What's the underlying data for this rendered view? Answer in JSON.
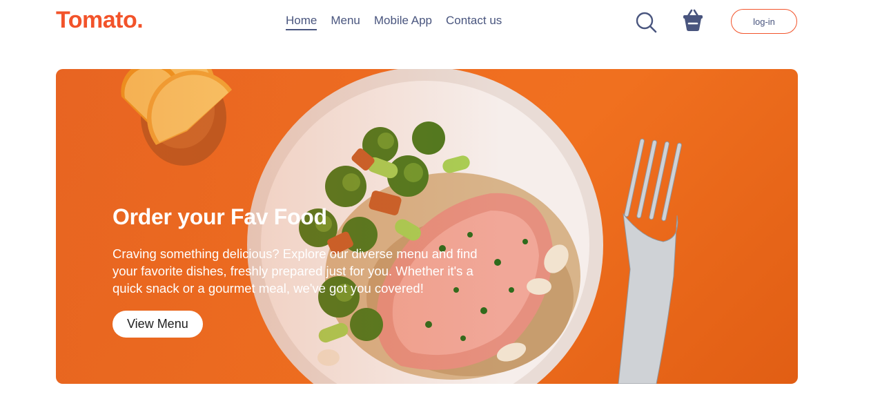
{
  "brand": {
    "logo": "Tomato.",
    "accent_color": "#f2532a"
  },
  "nav": {
    "items": [
      {
        "label": "Home",
        "active": true
      },
      {
        "label": "Menu",
        "active": false
      },
      {
        "label": "Mobile App",
        "active": false
      },
      {
        "label": "Contact us",
        "active": false
      }
    ],
    "search_icon": "search-icon",
    "basket_icon": "basket-icon",
    "login_label": "log-in"
  },
  "hero": {
    "title": "Order your Fav Food",
    "text": "Craving something delicious? Explore our diverse menu and find your favorite dishes, freshly prepared just for you. Whether it's a quick snack or a gourmet meal, we've got you covered!",
    "button_label": "View Menu",
    "background_color": "#ef6c22"
  }
}
